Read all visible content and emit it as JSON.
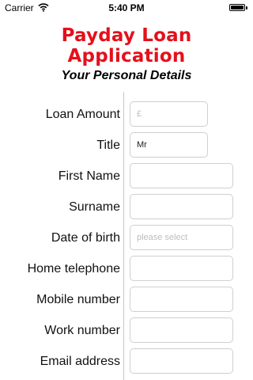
{
  "status_bar": {
    "carrier": "Carrier",
    "time": "5:40 PM"
  },
  "header": {
    "title": "Payday Loan Application",
    "subtitle": "Your Personal Details"
  },
  "form": {
    "loan_amount": {
      "label": "Loan Amount",
      "placeholder": "£",
      "value": ""
    },
    "title": {
      "label": "Title",
      "value": "Mr"
    },
    "first_name": {
      "label": "First Name",
      "value": ""
    },
    "surname": {
      "label": "Surname",
      "value": ""
    },
    "date_of_birth": {
      "label": "Date of birth",
      "placeholder": "please select",
      "value": ""
    },
    "home_telephone": {
      "label": "Home telephone",
      "value": ""
    },
    "mobile_number": {
      "label": "Mobile number",
      "value": ""
    },
    "work_number": {
      "label": "Work number",
      "value": ""
    },
    "email_address": {
      "label": "Email address",
      "value": ""
    }
  },
  "colors": {
    "title": "#e4101b",
    "divider": "#c7c7cc",
    "field_border": "#cfcfcf"
  }
}
